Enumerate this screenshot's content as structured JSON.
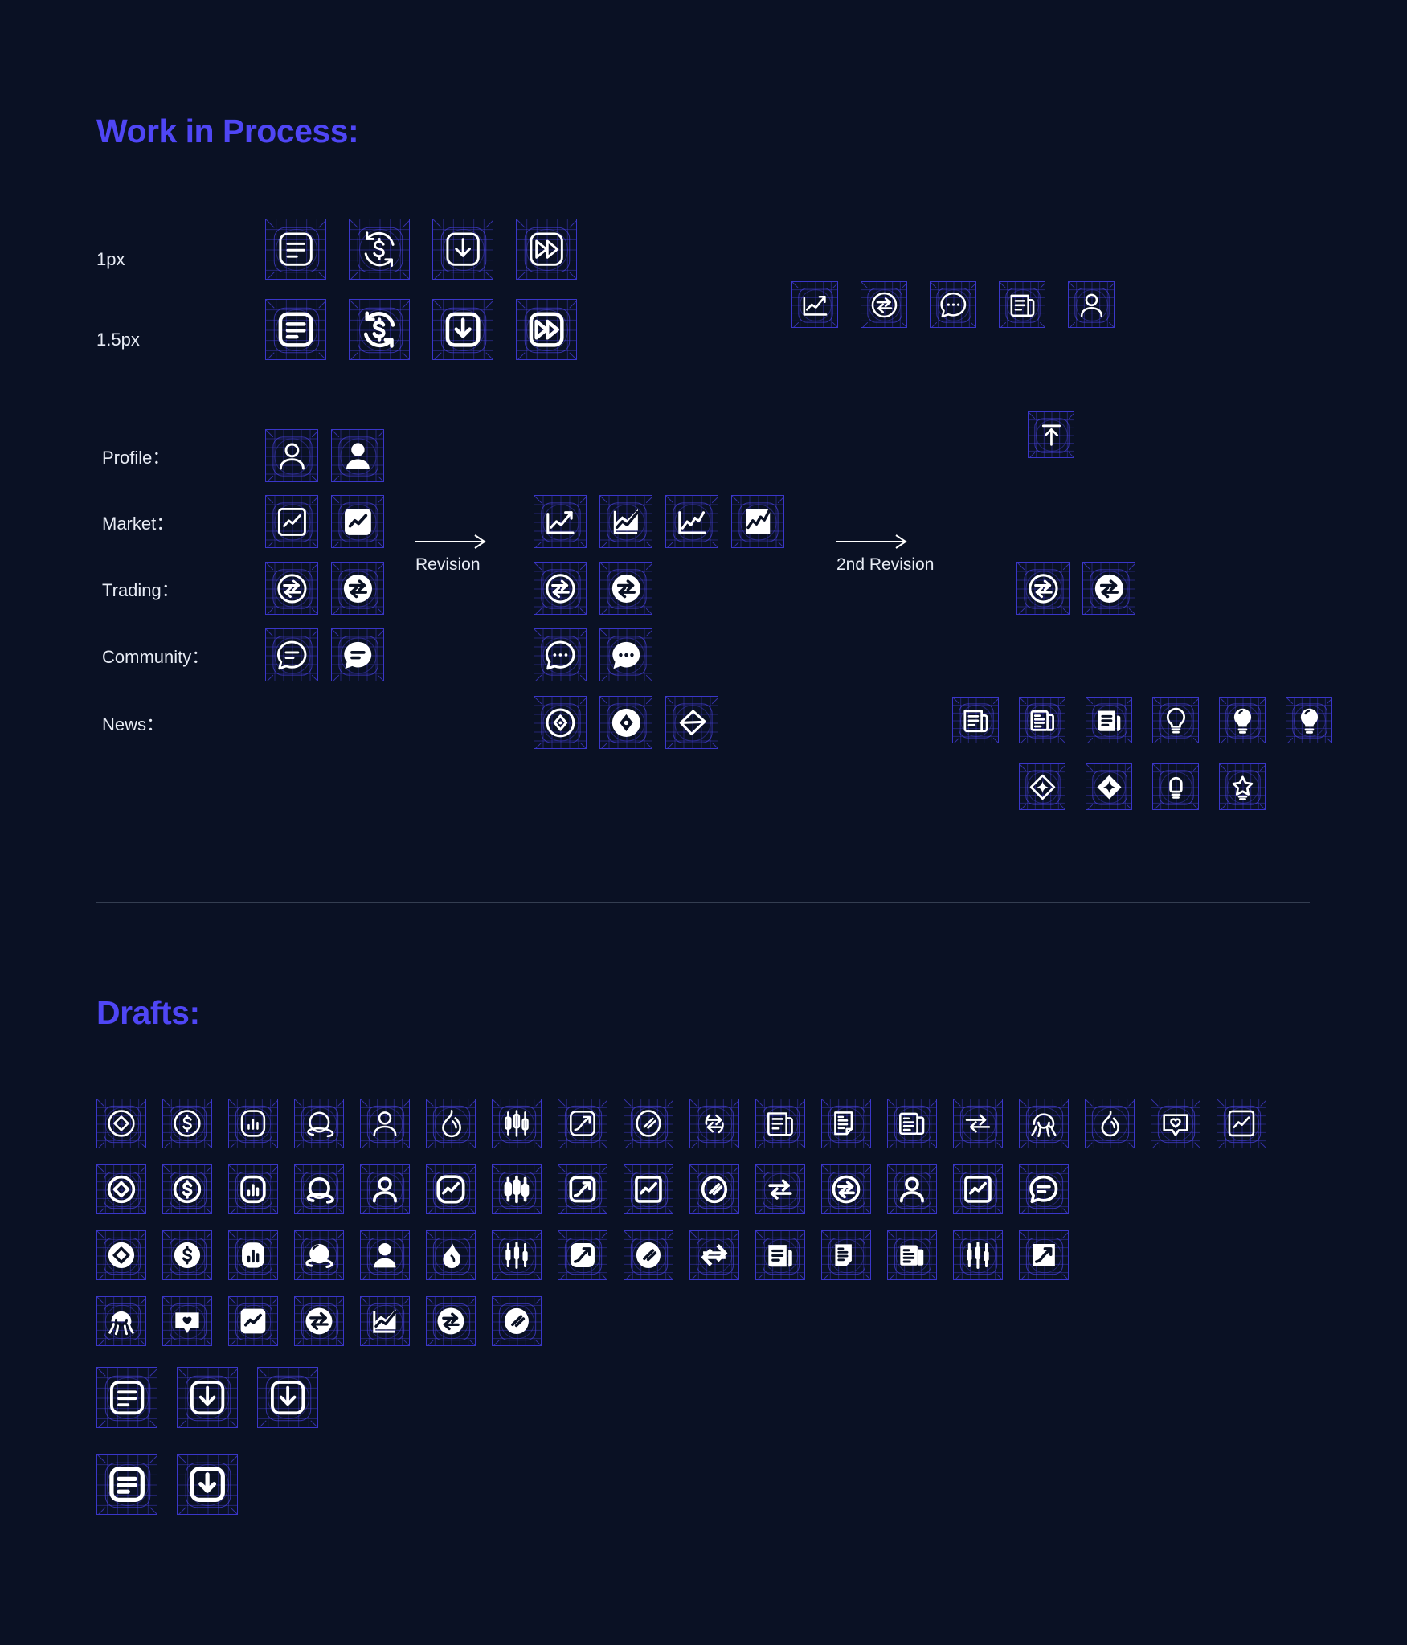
{
  "page": {
    "background_color": "#0a1124",
    "accent_color": "#4f46f5",
    "frame_color": "#3a36c9",
    "icon_color": "#ffffff",
    "divider_color": "#3c4759"
  },
  "sections": {
    "work_in_process": {
      "title": "Work in Process:"
    },
    "drafts": {
      "title": "Drafts:"
    }
  },
  "stroke_rows": [
    {
      "label": "1px"
    },
    {
      "label": "1.5px"
    }
  ],
  "category_rows": [
    {
      "label": "Profile："
    },
    {
      "label": "Market："
    },
    {
      "label": "Trading："
    },
    {
      "label": "Community："
    },
    {
      "label": "News："
    }
  ],
  "revisions": [
    {
      "label": "Revision"
    },
    {
      "label": "2nd Revision"
    }
  ],
  "wip_stroke_icons": {
    "row_1px": [
      "document-lines-icon",
      "dollar-refresh-icon",
      "download-icon",
      "fast-forward-icon"
    ],
    "row_15px": [
      "document-lines-icon",
      "dollar-refresh-icon",
      "download-icon",
      "fast-forward-icon"
    ],
    "top_right": [
      "chart-trend-icon",
      "exchange-circle-icon",
      "chat-dots-icon",
      "news-page-icon",
      "profile-icon"
    ],
    "upload": [
      "upload-arrow-icon"
    ]
  },
  "wip_categories": {
    "profile": {
      "initial": [
        "profile-outline-icon",
        "profile-filled-icon"
      ],
      "revision": [],
      "second_revision": []
    },
    "market": {
      "initial": [
        "chart-square-outline-icon",
        "chart-square-filled-icon"
      ],
      "revision": [
        "chart-trend-outline-icon",
        "chart-trend-filled-icon",
        "chart-zigzag-outline-icon",
        "chart-zigzag-filled-icon"
      ],
      "second_revision": []
    },
    "trading": {
      "initial": [
        "exchange-circle-outline-icon",
        "exchange-circle-filled-icon"
      ],
      "revision": [
        "exchange-circle-outline-icon",
        "exchange-circle-filled-icon"
      ],
      "second_revision": [
        "exchange-circle-outline-icon",
        "exchange-circle-filled-icon"
      ]
    },
    "community": {
      "initial": [
        "chat-lines-outline-icon",
        "chat-lines-filled-icon"
      ],
      "revision": [
        "chat-dots-outline-icon",
        "chat-dots-filled-icon"
      ],
      "second_revision": []
    },
    "news": {
      "initial": [],
      "revision": [
        "compass-circle-outline-icon",
        "compass-circle-filled-icon",
        "compass-diamond-icon"
      ],
      "second_revision": [
        "news-page-outline-icon",
        "news-stack-outline-icon",
        "news-page-filled-icon",
        "bulb-outline-icon",
        "bulb-filled-icon",
        "bulb-glow-icon",
        "sparkle-diamond-outline-icon",
        "sparkle-diamond-filled-icon",
        "bulb-square-icon",
        "bulb-star-icon"
      ]
    }
  },
  "draft_rows": [
    {
      "weight": "thin",
      "icons": [
        "diamond-circle-outline-icon",
        "dollar-circle-outline-icon",
        "bar-chart-outline-icon",
        "planet-outline-icon",
        "profile-outline-icon",
        "flame-outline-icon",
        "candlestick-outline-icon",
        "trend-arrow-square-icon",
        "slash-circle-outline-icon",
        "swap-arrows-outline-icon",
        "news-page-outline-icon",
        "news-page-fold-icon",
        "news-stack-outline-icon",
        "double-arrow-outline-icon",
        "jellyfish-outline-icon",
        "flame-round-outline-icon",
        "heart-chat-outline-icon",
        "chart-square-outline-icon"
      ]
    },
    {
      "weight": "medium",
      "icons": [
        "diamond-circle-outline-icon",
        "dollar-circle-outline-icon",
        "bar-chart-outline-icon",
        "planet-outline-icon",
        "profile-outline-icon",
        "chart-squircle-outline-icon",
        "candlestick-outline-icon",
        "trend-arrow-square-icon",
        "chart-trend-square-icon",
        "slash-circle-outline-icon",
        "swap-arrows-bold-icon",
        "exchange-circle-outline-icon",
        "profile-outline-icon",
        "chart-square-outline-icon",
        "chat-lines-outline-icon"
      ]
    },
    {
      "weight": "filled",
      "icons": [
        "diamond-circle-filled-icon",
        "dollar-circle-filled-icon",
        "bar-chart-filled-icon",
        "planet-filled-icon",
        "profile-filled-icon",
        "flame-filled-icon",
        "candlestick-filled-icon",
        "trend-arrow-square-filled-icon",
        "slash-circle-filled-icon",
        "swap-arrows-filled-icon",
        "news-page-filled-icon",
        "news-page-fold-filled-icon",
        "news-stack-filled-icon",
        "candlestick-filled-icon",
        "trend-arrow-filled-icon"
      ]
    },
    {
      "weight": "filled",
      "icons": [
        "jellyfish-filled-icon",
        "heart-chat-filled-icon",
        "chart-square-filled-icon",
        "swap-arrows-circle-filled-icon",
        "chart-trend-filled-icon",
        "exchange-circle-filled-icon",
        "slash-circle-filled-icon"
      ]
    },
    {
      "weight": "thin-large",
      "icons": [
        "document-lines-icon",
        "download-icon",
        "download-icon"
      ]
    },
    {
      "weight": "medium-large",
      "icons": [
        "document-lines-icon",
        "download-icon"
      ]
    }
  ]
}
